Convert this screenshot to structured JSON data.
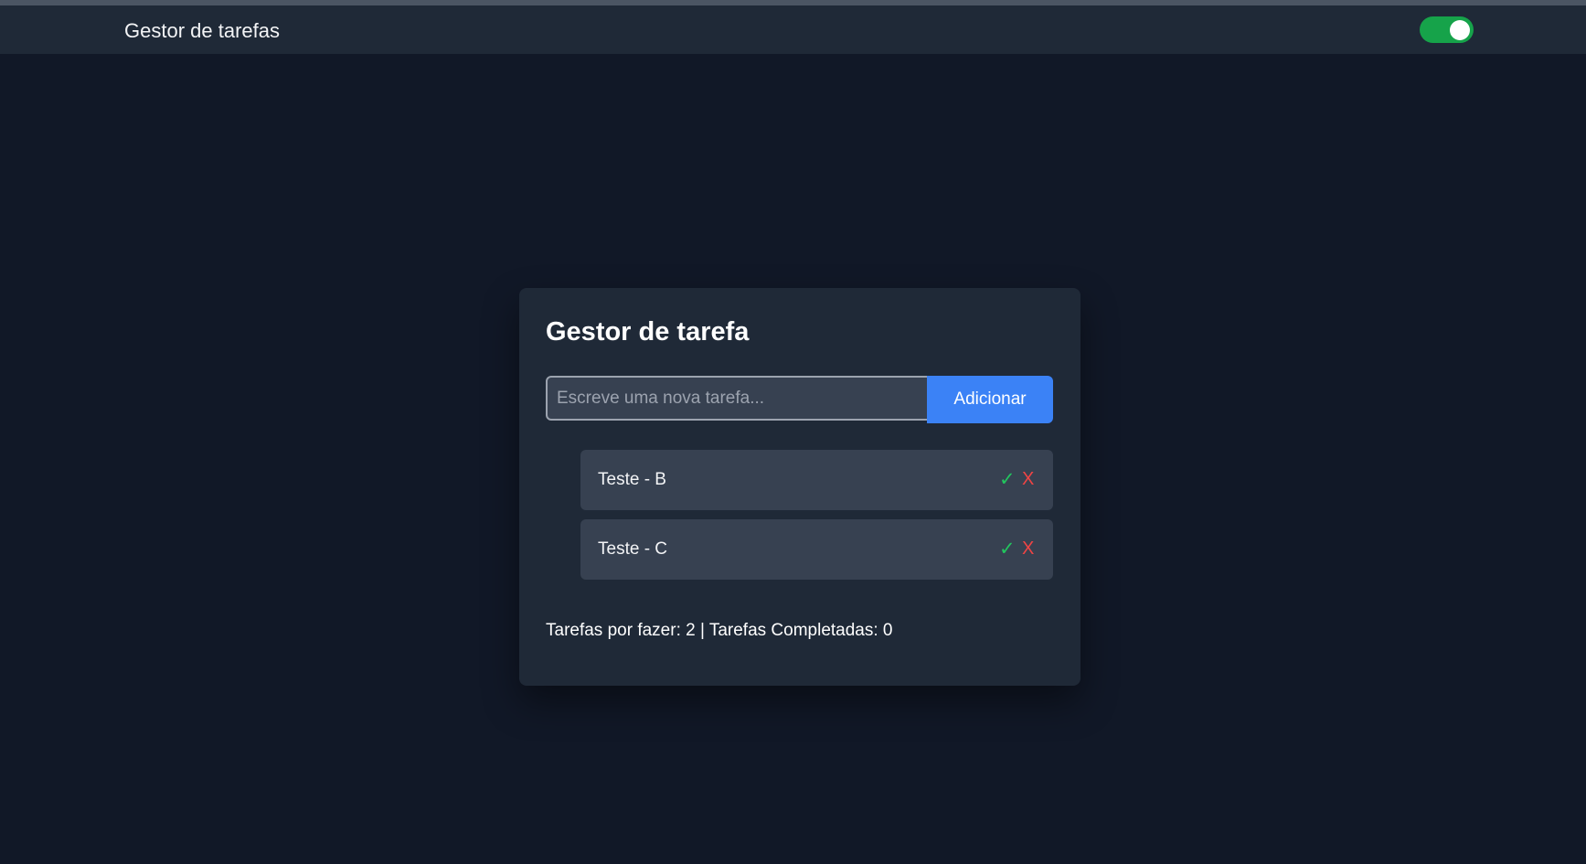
{
  "navbar": {
    "title": "Gestor de tarefas",
    "theme_toggle": {
      "state": "on",
      "color": "#16a34a"
    }
  },
  "card": {
    "title": "Gestor de tarefa",
    "input": {
      "value": "",
      "placeholder": "Escreve uma nova tarefa..."
    },
    "add_button_label": "Adicionar",
    "tasks": [
      {
        "label": "Teste - B",
        "complete_icon": "✓",
        "delete_icon": "X"
      },
      {
        "label": "Teste - C",
        "complete_icon": "✓",
        "delete_icon": "X"
      }
    ],
    "stats_text": "Tarefas por fazer: 2 | Tarefas Completadas: 0"
  },
  "colors": {
    "background": "#111827",
    "surface": "#1f2937",
    "item": "#374151",
    "accent": "#3b82f6",
    "complete": "#22c55e",
    "delete": "#ef4444"
  }
}
